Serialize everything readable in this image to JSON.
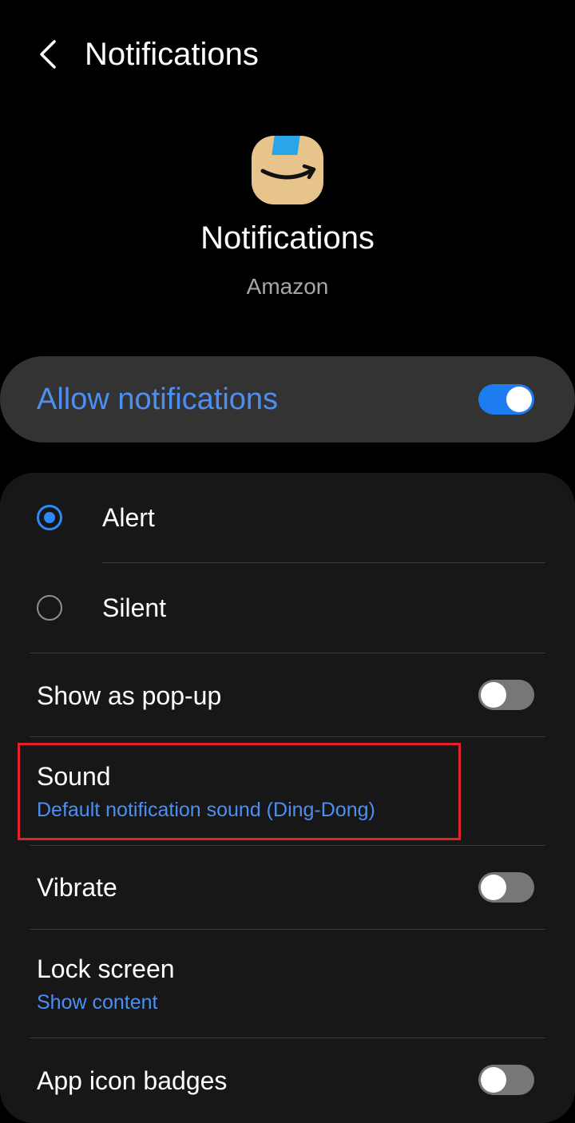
{
  "header": {
    "title": "Notifications"
  },
  "app": {
    "icon_name": "amazon-app-icon",
    "title": "Notifications",
    "name": "Amazon"
  },
  "allow_notifications": {
    "label": "Allow notifications",
    "enabled": true
  },
  "mode": {
    "options": [
      {
        "label": "Alert",
        "selected": true
      },
      {
        "label": "Silent",
        "selected": false
      }
    ]
  },
  "settings": {
    "show_popup": {
      "label": "Show as pop-up",
      "enabled": false
    },
    "sound": {
      "label": "Sound",
      "value": "Default notification sound (Ding-Dong)"
    },
    "vibrate": {
      "label": "Vibrate",
      "enabled": false
    },
    "lock_screen": {
      "label": "Lock screen",
      "value": "Show content"
    },
    "app_icon_badges": {
      "label": "App icon badges",
      "enabled": false
    }
  },
  "colors": {
    "accent": "#4c8ff3",
    "toggle_on": "#1e7cf2",
    "highlight": "#e0212a"
  }
}
